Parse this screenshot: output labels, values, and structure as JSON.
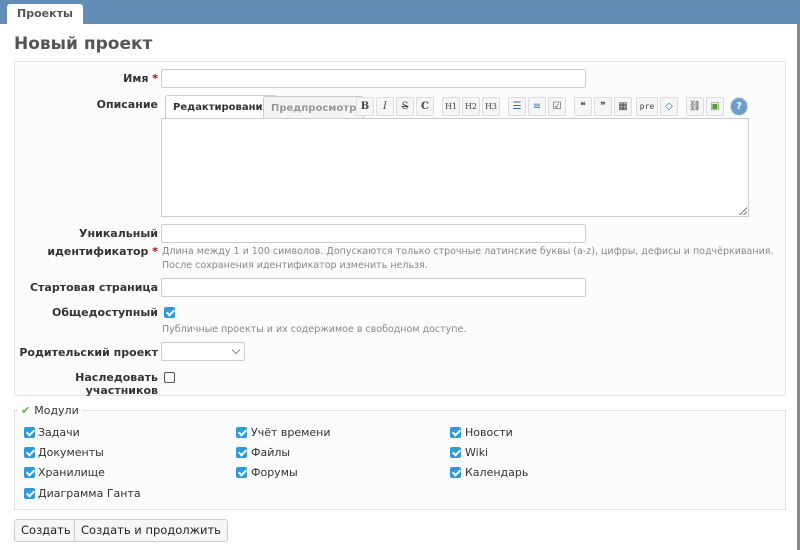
{
  "topbar": {
    "tab": "Проекты"
  },
  "page": {
    "title": "Новый проект"
  },
  "form": {
    "name_label": "Имя",
    "required_mark": "*",
    "name_value": "",
    "description_label": "Описание",
    "editor_tabs": [
      "Редактирование",
      "Предпросмотр"
    ],
    "toolbar_icons": [
      {
        "icon": "bold-icon",
        "glyph": "B"
      },
      {
        "icon": "italic-icon",
        "glyph": "I"
      },
      {
        "icon": "strike-icon",
        "glyph": "S"
      },
      {
        "icon": "code-icon",
        "glyph": "C"
      },
      {
        "icon": "h1-icon",
        "glyph": "H1"
      },
      {
        "icon": "h2-icon",
        "glyph": "H2"
      },
      {
        "icon": "h3-icon",
        "glyph": "H3"
      },
      {
        "icon": "bullet-list-icon",
        "glyph": "☰"
      },
      {
        "icon": "numbered-list-icon",
        "glyph": "≡"
      },
      {
        "icon": "checklist-icon",
        "glyph": "☑"
      },
      {
        "icon": "quote-icon",
        "glyph": "❝"
      },
      {
        "icon": "unquote-icon",
        "glyph": "❞"
      },
      {
        "icon": "table-icon",
        "glyph": "▦"
      },
      {
        "icon": "pre-icon",
        "glyph": "pre"
      },
      {
        "icon": "code-link-icon",
        "glyph": "◇"
      },
      {
        "icon": "link-icon",
        "glyph": "⛓"
      },
      {
        "icon": "image-icon",
        "glyph": "▣"
      },
      {
        "icon": "help-icon",
        "glyph": "?"
      }
    ],
    "identifier_label_1": "Уникальный",
    "identifier_label_2": "идентификатор",
    "identifier_hint_1": "Длина между 1 и 100 символов. Допускаются только строчные латинские буквы (a-z), цифры, дефисы и подчёркивания.",
    "identifier_hint_2": "После сохранения идентификатор изменить нельзя.",
    "homepage_label": "Стартовая страница",
    "public_label": "Общедоступный",
    "public_hint": "Публичные проекты и их содержимое в свободном доступе.",
    "public_checked": true,
    "parent_label": "Родительский проект",
    "parent_value": "",
    "inherit_label": "Наследовать участников",
    "inherit_checked": false
  },
  "modules": {
    "legend": "Модули",
    "items": [
      {
        "label": "Задачи",
        "checked": true
      },
      {
        "label": "Учёт времени",
        "checked": true
      },
      {
        "label": "Новости",
        "checked": true
      },
      {
        "label": "Документы",
        "checked": true
      },
      {
        "label": "Файлы",
        "checked": true
      },
      {
        "label": "Wiki",
        "checked": true
      },
      {
        "label": "Хранилище",
        "checked": true
      },
      {
        "label": "Форумы",
        "checked": true
      },
      {
        "label": "Календарь",
        "checked": true
      },
      {
        "label": "Диаграмма Ганта",
        "checked": true
      }
    ]
  },
  "actions": {
    "create": "Создать",
    "create_continue": "Создать и продолжить"
  }
}
